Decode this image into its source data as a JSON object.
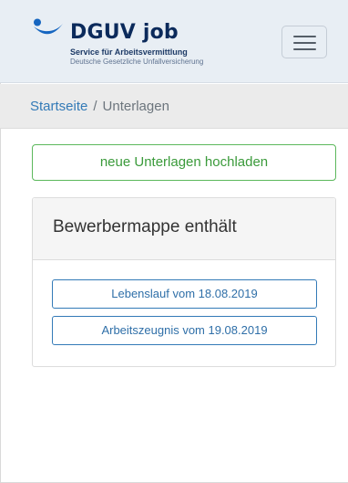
{
  "header": {
    "logo_title": "DGUV job",
    "logo_subtitle": "Service für Arbeitsvermittlung",
    "logo_org": "Deutsche Gesetzliche Unfallversicherung",
    "menu_icon": "hamburger-icon"
  },
  "breadcrumb": {
    "home": "Startseite",
    "separator": "/",
    "current": "Unterlagen"
  },
  "actions": {
    "upload_label": "neue Unterlagen hochladen"
  },
  "portfolio": {
    "title": "Bewerbermappe enthält",
    "documents": [
      {
        "label": "Lebenslauf vom 18.08.2019"
      },
      {
        "label": "Arbeitszeugnis vom 19.08.2019"
      }
    ]
  },
  "colors": {
    "brand_navy": "#0b2a5b",
    "header_bg": "#e8eef4",
    "link_blue": "#337ab7",
    "success_green": "#5cb85c"
  }
}
